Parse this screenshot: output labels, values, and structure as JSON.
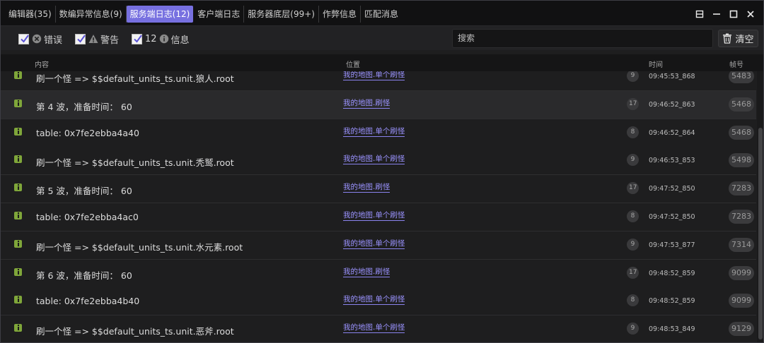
{
  "tabs": [
    {
      "label": "编辑器(35)",
      "active": false
    },
    {
      "label": "数编异常信息(9)",
      "active": false
    },
    {
      "label": "服务端日志(12)",
      "active": true
    },
    {
      "label": "客户端日志",
      "active": false
    },
    {
      "label": "服务器底层(99+)",
      "active": false
    },
    {
      "label": "作弊信息",
      "active": false
    },
    {
      "label": "匹配消息",
      "active": false
    }
  ],
  "window_buttons": [
    "restore-icon",
    "minimize-icon",
    "maximize-icon",
    "close-icon"
  ],
  "filters": {
    "error": {
      "label": "错误",
      "checked": true,
      "icon": "error-icon"
    },
    "warning": {
      "label": "警告",
      "checked": true,
      "icon": "warning-icon"
    },
    "info": {
      "count": "12",
      "label": "信息",
      "checked": true,
      "icon": "info-icon"
    }
  },
  "search": {
    "placeholder": "搜索",
    "value": ""
  },
  "clear_button": {
    "label": "清空",
    "icon": "trash-icon"
  },
  "columns": {
    "content": "内容",
    "location": "位置",
    "time": "时间",
    "frame": "帧号"
  },
  "colors": {
    "accent": "#7770e0",
    "link": "#9b93ff",
    "info_icon": "#7fa63a"
  },
  "rows": [
    {
      "content": "刷一个怪 => $$default_units_ts.unit.狼人.root",
      "location": "我的地图.单个刷怪",
      "level": "9",
      "time": "09:45:53_868",
      "frame": "5483"
    },
    {
      "content": "第 4 波，准备时间： 60",
      "location": "我的地图.刷怪",
      "level": "17",
      "time": "09:46:52_863",
      "frame": "5468"
    },
    {
      "content": "table: 0x7fe2ebba4a40",
      "location": "我的地图.单个刷怪",
      "level": "8",
      "time": "09:46:52_864",
      "frame": "5468"
    },
    {
      "content": "刷一个怪 => $$default_units_ts.unit.秃鹫.root",
      "location": "我的地图.单个刷怪",
      "level": "9",
      "time": "09:46:53_853",
      "frame": "5498"
    },
    {
      "content": "第 5 波，准备时间： 60",
      "location": "我的地图.刷怪",
      "level": "17",
      "time": "09:47:52_850",
      "frame": "7283"
    },
    {
      "content": "table: 0x7fe2ebba4ac0",
      "location": "我的地图.单个刷怪",
      "level": "8",
      "time": "09:47:52_850",
      "frame": "7283"
    },
    {
      "content": "刷一个怪 => $$default_units_ts.unit.水元素.root",
      "location": "我的地图.单个刷怪",
      "level": "9",
      "time": "09:47:53_877",
      "frame": "7314"
    },
    {
      "content": "第 6 波，准备时间： 60",
      "location": "我的地图.刷怪",
      "level": "17",
      "time": "09:48:52_859",
      "frame": "9099"
    },
    {
      "content": "table: 0x7fe2ebba4b40",
      "location": "我的地图.单个刷怪",
      "level": "8",
      "time": "09:48:52_859",
      "frame": "9099"
    },
    {
      "content": "刷一个怪 => $$default_units_ts.unit.恶斧.root",
      "location": "我的地图.单个刷怪",
      "level": "9",
      "time": "09:48:53_849",
      "frame": "9129"
    }
  ]
}
